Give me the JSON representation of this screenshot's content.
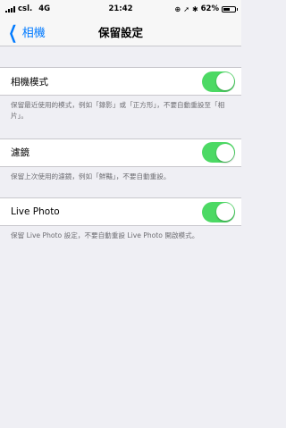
{
  "status_bar": {
    "carrier": "csl.",
    "network": "4G",
    "time": "21:42",
    "battery_percent": "62%",
    "battery_level": 0.62
  },
  "nav": {
    "back_label": "相機",
    "title": "保留設定"
  },
  "settings": [
    {
      "label": "相機模式",
      "enabled": true,
      "footer": "保留最近使用的模式，例如「錄影」或「正方形」，不要自動重設至「相片」。"
    },
    {
      "label": "濾鏡",
      "enabled": true,
      "footer": "保留上次使用的濾鏡，例如「鮮豔」，不要自動重設。"
    },
    {
      "label": "Live Photo",
      "enabled": true,
      "footer": "保留 Live Photo 設定，不要自動重設 Live Photo 開啟模式。"
    }
  ],
  "colors": {
    "accent": "#007aff",
    "toggle_on": "#4cd964",
    "background": "#efeff4"
  }
}
